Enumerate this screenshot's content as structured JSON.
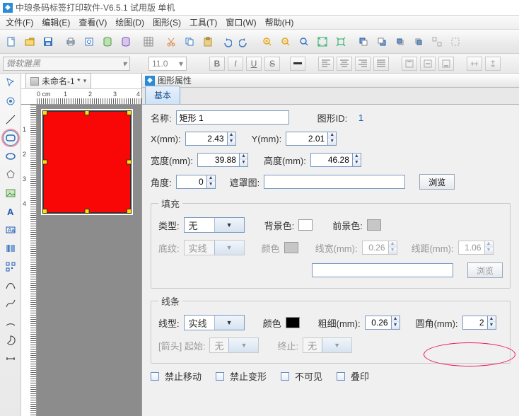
{
  "title": "中琅条码标签打印软件-V6.5.1 试用版 单机",
  "menus": [
    "文件(F)",
    "编辑(E)",
    "查看(V)",
    "绘图(D)",
    "图形(S)",
    "工具(T)",
    "窗口(W)",
    "帮助(H)"
  ],
  "fontbar": {
    "font_name": "微软雅黑",
    "font_size": "11.0",
    "btn_B": "B",
    "btn_I": "I",
    "btn_U": "U",
    "btn_S": "S"
  },
  "doc_tab": {
    "name": "未命名-1 *"
  },
  "ruler_top": [
    "0 cm",
    "1",
    "2",
    "3",
    "4"
  ],
  "ruler_left": [
    "1",
    "2",
    "3",
    "4"
  ],
  "panel": {
    "title": "图形属性",
    "tab": "基本",
    "name_label": "名称:",
    "name_value": "矩形 1",
    "id_label": "图形ID:",
    "id_value": "1",
    "x_label": "X(mm):",
    "x_value": "2.43",
    "y_label": "Y(mm):",
    "y_value": "2.01",
    "w_label": "宽度(mm):",
    "w_value": "39.88",
    "h_label": "高度(mm):",
    "h_value": "46.28",
    "angle_label": "角度:",
    "angle_value": "0",
    "mask_label": "遮罩图:",
    "browse": "浏览",
    "fill_legend": "填充",
    "fill_type_label": "类型:",
    "fill_type_value": "无",
    "bg_label": "背景色:",
    "fg_label": "前景色:",
    "pattern_label": "底纹:",
    "pattern_value": "实线",
    "color_label": "颜色",
    "linew_label": "线宽(mm):",
    "linew_value": "0.26",
    "spacing_label": "线距(mm):",
    "spacing_value": "1.06",
    "line_legend": "线条",
    "line_type_label": "线型:",
    "line_type_value": "实线",
    "thick_label": "粗细(mm):",
    "thick_value": "0.26",
    "corner_label": "圆角(mm):",
    "corner_value": "2",
    "arrow_label": "[箭头] 起始:",
    "arrow_start": "无",
    "arrow_end_label": "终止:",
    "arrow_end": "无",
    "cb_lock_move": "禁止移动",
    "cb_lock_shape": "禁止变形",
    "cb_hidden": "不可见",
    "cb_overlay": "叠印"
  }
}
